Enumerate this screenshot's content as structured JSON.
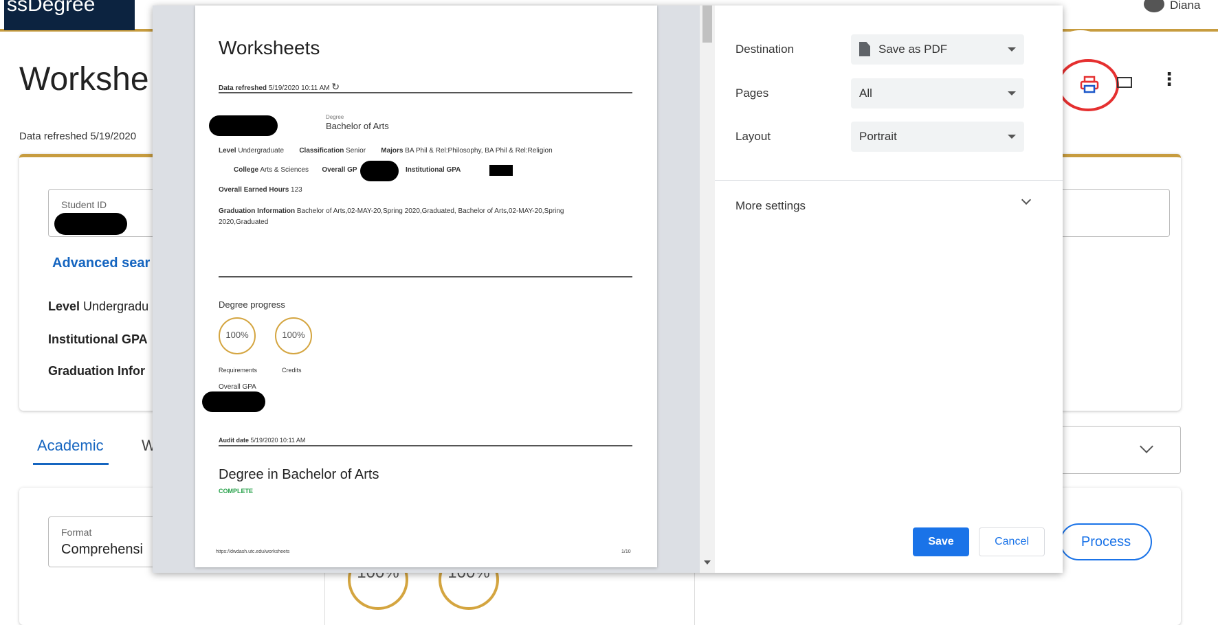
{
  "app": {
    "brand_fragment": "ssDegree",
    "user_fragment": "Diana",
    "page_title_fragment": "Workshe",
    "data_refreshed_fragment": "Data refreshed 5/19/2020",
    "student_id_label": "Student ID",
    "advanced_search_fragment": "Advanced sear",
    "level_label": "Level",
    "level_value_fragment": "Undergradu",
    "institutional_gpa_label": "Institutional GPA",
    "graduation_info_fragment": "Graduation Infor",
    "tabs": [
      {
        "label": "Academic"
      },
      {
        "label": "W"
      }
    ],
    "format_label": "Format",
    "format_value_fragment": "Comprehensi",
    "gauges": [
      {
        "value": "100%"
      },
      {
        "value": "100%"
      }
    ],
    "process_label": "Process",
    "icons": [
      "print-icon",
      "mail-icon",
      "kebab-menu-icon",
      "chevron-down-icon"
    ],
    "accent_color": "#c79c3f",
    "brand_color": "#0c2340",
    "link_color": "#1565c0"
  },
  "print_dialog": {
    "preview": {
      "title": "Worksheets",
      "data_refreshed_label": "Data refreshed",
      "data_refreshed_value": "5/19/2020 10:11 AM",
      "degree_label": "Degree",
      "degree_value": "Bachelor of Arts",
      "level_label": "Level",
      "level_value": "Undergraduate",
      "classification_label": "Classification",
      "classification_value": "Senior",
      "majors_label": "Majors",
      "majors_value": "BA Phil & Rel:Philosophy, BA Phil & Rel:Religion",
      "college_label": "College",
      "college_value": "Arts & Sciences",
      "overall_gpa_label_fragment": "Overall GP",
      "institutional_gpa_label": "Institutional GPA",
      "earned_hours_label": "Overall Earned Hours",
      "earned_hours_value": "123",
      "graduation_info_label": "Graduation Information",
      "graduation_info_value": "Bachelor of Arts,02-MAY-20,Spring 2020,Graduated, Bachelor of Arts,02-MAY-20,Spring 2020,Graduated",
      "degree_progress_label": "Degree progress",
      "progress_gauges": [
        {
          "value": "100%",
          "label": "Requirements"
        },
        {
          "value": "100%",
          "label": "Credits"
        }
      ],
      "overall_gpa_label": "Overall GPA",
      "audit_date_label": "Audit date",
      "audit_date_value": "5/19/2020 10:11 AM",
      "section_title": "Degree in Bachelor of Arts",
      "section_status": "COMPLETE",
      "footer_url": "https://dwdash.utc.edu/worksheets",
      "footer_page": "1/10"
    },
    "settings": {
      "destination_label": "Destination",
      "destination_value": "Save as PDF",
      "pages_label": "Pages",
      "pages_value": "All",
      "layout_label": "Layout",
      "layout_value": "Portrait",
      "more_settings_label": "More settings",
      "save_label": "Save",
      "cancel_label": "Cancel"
    },
    "primary_color": "#1a73e8",
    "complete_color": "#27a14a"
  }
}
